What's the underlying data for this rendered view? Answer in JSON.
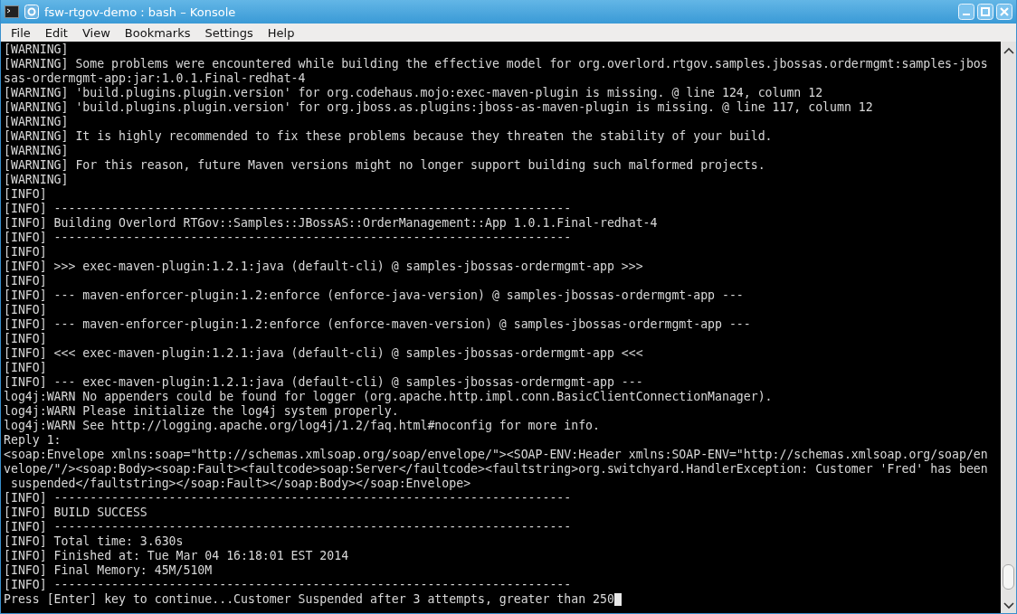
{
  "window": {
    "title": "fsw-rtgov-demo : bash – Konsole"
  },
  "menu": [
    "File",
    "Edit",
    "View",
    "Bookmarks",
    "Settings",
    "Help"
  ],
  "terminal": {
    "lines": [
      "[WARNING]",
      "[WARNING] Some problems were encountered while building the effective model for org.overlord.rtgov.samples.jbossas.ordermgmt:samples-jbos",
      "sas-ordermgmt-app:jar:1.0.1.Final-redhat-4",
      "[WARNING] 'build.plugins.plugin.version' for org.codehaus.mojo:exec-maven-plugin is missing. @ line 124, column 12",
      "[WARNING] 'build.plugins.plugin.version' for org.jboss.as.plugins:jboss-as-maven-plugin is missing. @ line 117, column 12",
      "[WARNING]",
      "[WARNING] It is highly recommended to fix these problems because they threaten the stability of your build.",
      "[WARNING]",
      "[WARNING] For this reason, future Maven versions might no longer support building such malformed projects.",
      "[WARNING]",
      "[INFO]",
      "[INFO] ------------------------------------------------------------------------",
      "[INFO] Building Overlord RTGov::Samples::JBossAS::OrderManagement::App 1.0.1.Final-redhat-4",
      "[INFO] ------------------------------------------------------------------------",
      "[INFO]",
      "[INFO] >>> exec-maven-plugin:1.2.1:java (default-cli) @ samples-jbossas-ordermgmt-app >>>",
      "[INFO]",
      "[INFO] --- maven-enforcer-plugin:1.2:enforce (enforce-java-version) @ samples-jbossas-ordermgmt-app ---",
      "[INFO]",
      "[INFO] --- maven-enforcer-plugin:1.2:enforce (enforce-maven-version) @ samples-jbossas-ordermgmt-app ---",
      "[INFO]",
      "[INFO] <<< exec-maven-plugin:1.2.1:java (default-cli) @ samples-jbossas-ordermgmt-app <<<",
      "[INFO]",
      "[INFO] --- exec-maven-plugin:1.2.1:java (default-cli) @ samples-jbossas-ordermgmt-app ---",
      "log4j:WARN No appenders could be found for logger (org.apache.http.impl.conn.BasicClientConnectionManager).",
      "log4j:WARN Please initialize the log4j system properly.",
      "log4j:WARN See http://logging.apache.org/log4j/1.2/faq.html#noconfig for more info.",
      "Reply 1:",
      "<soap:Envelope xmlns:soap=\"http://schemas.xmlsoap.org/soap/envelope/\"><SOAP-ENV:Header xmlns:SOAP-ENV=\"http://schemas.xmlsoap.org/soap/en",
      "velope/\"/><soap:Body><soap:Fault><faultcode>soap:Server</faultcode><faultstring>org.switchyard.HandlerException: Customer 'Fred' has been",
      " suspended</faultstring></soap:Fault></soap:Body></soap:Envelope>",
      "[INFO] ------------------------------------------------------------------------",
      "[INFO] BUILD SUCCESS",
      "[INFO] ------------------------------------------------------------------------",
      "[INFO] Total time: 3.630s",
      "[INFO] Finished at: Tue Mar 04 16:18:01 EST 2014",
      "[INFO] Final Memory: 45M/510M",
      "[INFO] ------------------------------------------------------------------------",
      "Press [Enter] key to continue...Customer Suspended after 3 attempts, greater than 250"
    ]
  }
}
